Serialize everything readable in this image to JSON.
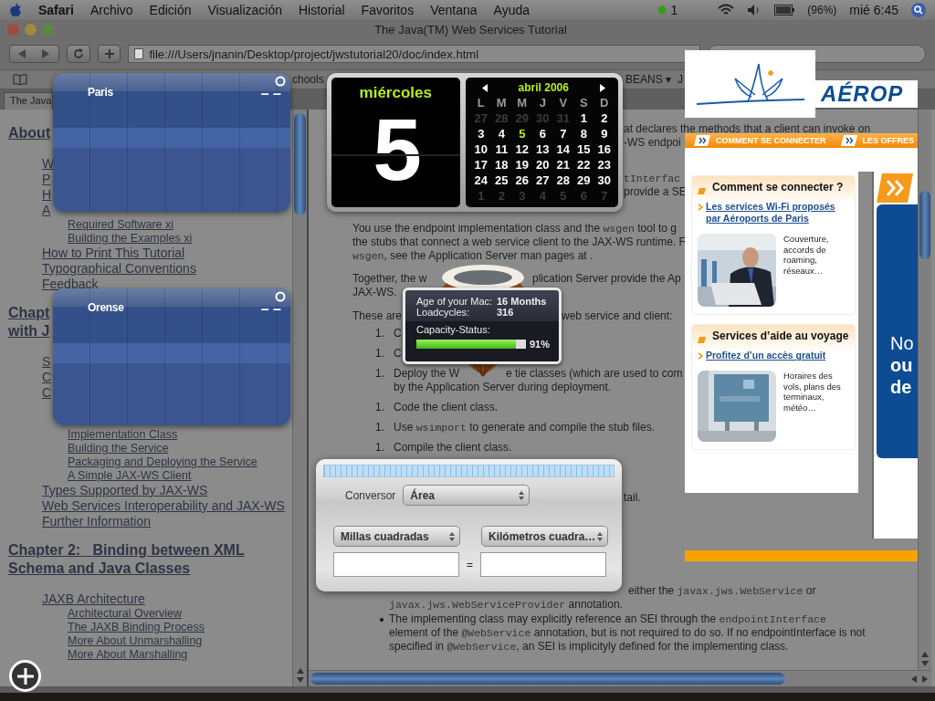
{
  "menubar": {
    "app": "Safari",
    "menus": [
      "Archivo",
      "Edición",
      "Visualización",
      "Historial",
      "Favoritos",
      "Ventana",
      "Ayuda"
    ],
    "status": "1",
    "battery": "(96%)",
    "clock": "mié 6:45"
  },
  "window": {
    "title": "The Java(TM) Web Services Tutorial"
  },
  "toolbar": {
    "url": "file:///Users/jnanin/Desktop/project/jwstutorial20/doc/index.html"
  },
  "bookmarks": [
    "chools",
    "BEANS ▾",
    "J"
  ],
  "tabs": [
    {
      "label": "The Java",
      "selected": true
    }
  ],
  "toc": [
    {
      "title": "About",
      "items": [
        {
          "text": "W"
        },
        {
          "text": "P"
        },
        {
          "text": "H"
        },
        {
          "text": "A",
          "children": [
            {
              "text": "Required Software xi"
            },
            {
              "text": "Building the Examples xi"
            }
          ]
        },
        {
          "text": "How to Print This Tutorial"
        },
        {
          "text": "Typographical Conventions"
        },
        {
          "text": "Feedback"
        }
      ]
    },
    {
      "title": "Chapt\nwith J",
      "items": [
        {
          "text": "S"
        },
        {
          "text": "C"
        },
        {
          "text": "C",
          "children": [
            {
              "text": "Implementation Class"
            },
            {
              "text": "Building the Service"
            },
            {
              "text": "Packaging and Deploying the Service"
            },
            {
              "text": "A Simple JAX-WS Client"
            }
          ]
        },
        {
          "text": "Types Supported by JAX-WS"
        },
        {
          "text": "Web Services Interoperability and JAX-WS"
        },
        {
          "text": "Further Information"
        }
      ]
    },
    {
      "title": "Chapter 2:   Binding between XML\nSchema and Java Classes",
      "items": [
        {
          "text": "JAXB Architecture",
          "children": [
            {
              "text": "Architectural Overview"
            },
            {
              "text": "The JAXB Binding Process"
            },
            {
              "text": "More About Unmarshalling"
            },
            {
              "text": "More About Marshalling"
            }
          ]
        }
      ]
    }
  ],
  "content": [
    {
      "kind": "tail",
      "lines": [
        [
          [
            {
              "text": "at declares the methods that a client can invoke on"
            }
          ]
        ],
        [
          [
            {
              "text": "-WS endpoi"
            }
          ]
        ]
      ]
    },
    {
      "kind": "tail",
      "lines": [
        [
          [
            {
              "code": "tInterfac"
            }
          ]
        ],
        [
          [
            {
              "text": "provide a SE"
            }
          ]
        ]
      ]
    },
    {
      "kind": "para",
      "lines": [
        [
          [
            {
              "text": "You use the endpoint implementation class and the "
            },
            {
              "code": "wsgen"
            },
            {
              "text": " tool to g"
            }
          ]
        ],
        [
          [
            {
              "text": "the stubs that connect a web service client to the JAX-WS runtime. F"
            }
          ]
        ],
        [
          [
            {
              "code": "wsgen"
            },
            {
              "text": ", see the Application Server man pages at ."
            }
          ]
        ]
      ]
    },
    {
      "kind": "para",
      "lines": [
        [
          [
            {
              "text": "Together, the w"
            }
          ],
          [
            {
              "text": "plication Server provide the Ap"
            }
          ]
        ],
        [
          [
            {
              "text": "JAX-WS."
            }
          ]
        ]
      ]
    },
    {
      "kind": "para",
      "lines": [
        [
          [
            {
              "text": "These are"
            }
          ],
          [
            {
              "text": "web service and client:"
            }
          ]
        ]
      ]
    },
    {
      "kind": "step",
      "number": "1.",
      "lines": [
        [
          [
            {
              "text": "C"
            }
          ]
        ]
      ]
    },
    {
      "kind": "step",
      "number": "1.",
      "lines": [
        [
          [
            {
              "text": "C"
            }
          ]
        ]
      ]
    },
    {
      "kind": "step",
      "number": "1.",
      "lines": [
        [
          [
            {
              "text": "Deploy the W"
            }
          ],
          [
            {
              "text": "e tie classes (which are used to com"
            }
          ]
        ],
        [
          [
            {
              "text": "by the Application Server during deployment."
            }
          ]
        ]
      ]
    },
    {
      "kind": "step",
      "number": "1.",
      "lines": [
        [
          [
            {
              "text": "Code the client class."
            }
          ]
        ]
      ]
    },
    {
      "kind": "step",
      "number": "1.",
      "lines": [
        [
          [
            {
              "text": "Use "
            },
            {
              "code": "wsimport"
            },
            {
              "text": " to generate and compile the stub files."
            }
          ]
        ]
      ]
    },
    {
      "kind": "step",
      "number": "1.",
      "lines": [
        [
          [
            {
              "text": "Compile the client class."
            }
          ]
        ]
      ]
    },
    {
      "kind": "tail",
      "lines": [
        [
          [
            {
              "text": "tail."
            }
          ]
        ]
      ]
    },
    {
      "kind": "continued",
      "lines": [
        [
          [
            {
              "text": "either the "
            },
            {
              "code": "javax.jws.WebService"
            },
            {
              "text": " or"
            }
          ]
        ],
        [
          [
            {
              "code": "javax.jws.WebServiceProvider"
            },
            {
              "text": " annotation."
            }
          ]
        ]
      ]
    },
    {
      "kind": "bullet",
      "lines": [
        [
          [
            {
              "text": "The implementing class may explicitly reference an SEI through the "
            },
            {
              "code": "endpointInterface"
            }
          ]
        ],
        [
          [
            {
              "text": "element of the "
            },
            {
              "code": "@WebService"
            },
            {
              "text": " annotation, but is not required to do so. If no endpointInterface is not"
            }
          ]
        ],
        [
          [
            {
              "text": "specified in "
            },
            {
              "code": "@WebService"
            },
            {
              "text": ", an SEI is implicityly defined for the implementing class."
            }
          ]
        ]
      ]
    }
  ],
  "weather": [
    {
      "city": "Paris",
      "reading": "– –"
    },
    {
      "city": "Orense",
      "reading": "– –"
    }
  ],
  "calendar": {
    "weekday": "miércoles",
    "day": "5",
    "month": "abril 2006",
    "weekdays": [
      "L",
      "M",
      "M",
      "J",
      "V",
      "S",
      "D"
    ],
    "weeks": [
      [
        {
          "d": "27",
          "other": true,
          "selected": false
        },
        {
          "d": "28",
          "other": true,
          "selected": false
        },
        {
          "d": "29",
          "other": true,
          "selected": false
        },
        {
          "d": "30",
          "other": true,
          "selected": false
        },
        {
          "d": "31",
          "other": true,
          "selected": false
        },
        {
          "d": "1",
          "other": false,
          "selected": false
        },
        {
          "d": "2",
          "other": false,
          "selected": false
        }
      ],
      [
        {
          "d": "3",
          "other": false,
          "selected": false
        },
        {
          "d": "4",
          "other": false,
          "selected": false
        },
        {
          "d": "5",
          "other": false,
          "selected": true
        },
        {
          "d": "6",
          "other": false,
          "selected": false
        },
        {
          "d": "7",
          "other": false,
          "selected": false
        },
        {
          "d": "8",
          "other": false,
          "selected": false
        },
        {
          "d": "9",
          "other": false,
          "selected": false
        }
      ],
      [
        {
          "d": "10",
          "other": false,
          "selected": false
        },
        {
          "d": "11",
          "other": false,
          "selected": false
        },
        {
          "d": "12",
          "other": false,
          "selected": false
        },
        {
          "d": "13",
          "other": false,
          "selected": false
        },
        {
          "d": "14",
          "other": false,
          "selected": false
        },
        {
          "d": "15",
          "other": false,
          "selected": false
        },
        {
          "d": "16",
          "other": false,
          "selected": false
        }
      ],
      [
        {
          "d": "17",
          "other": false,
          "selected": false
        },
        {
          "d": "18",
          "other": false,
          "selected": false
        },
        {
          "d": "19",
          "other": false,
          "selected": false
        },
        {
          "d": "20",
          "other": false,
          "selected": false
        },
        {
          "d": "21",
          "other": false,
          "selected": false
        },
        {
          "d": "22",
          "other": false,
          "selected": false
        },
        {
          "d": "23",
          "other": false,
          "selected": false
        }
      ],
      [
        {
          "d": "24",
          "other": false,
          "selected": false
        },
        {
          "d": "25",
          "other": false,
          "selected": false
        },
        {
          "d": "26",
          "other": false,
          "selected": false
        },
        {
          "d": "27",
          "other": false,
          "selected": false
        },
        {
          "d": "28",
          "other": false,
          "selected": false
        },
        {
          "d": "29",
          "other": false,
          "selected": false
        },
        {
          "d": "30",
          "other": false,
          "selected": false
        }
      ],
      [
        {
          "d": "1",
          "other": true,
          "selected": false
        },
        {
          "d": "2",
          "other": true,
          "selected": false
        },
        {
          "d": "3",
          "other": true,
          "selected": false
        },
        {
          "d": "4",
          "other": true,
          "selected": false
        },
        {
          "d": "5",
          "other": true,
          "selected": false
        },
        {
          "d": "6",
          "other": true,
          "selected": false
        },
        {
          "d": "7",
          "other": true,
          "selected": false
        }
      ]
    ]
  },
  "battery": {
    "rows": [
      {
        "label": "Age of your Mac:",
        "value": "16 Months"
      },
      {
        "label": "Loadcycles:",
        "value": "316"
      }
    ],
    "capacity": {
      "label": "Capacity-Status:",
      "level": 0.91,
      "reading": "91%"
    }
  },
  "converter": {
    "label": "Conversor",
    "category": "Área",
    "from_unit": "Millas cuadradas",
    "to_unit": "Kilómetros cuadra…",
    "equals": "="
  },
  "airport": {
    "brand": "AÉROP",
    "nav": [
      "COMMENT SE CONNECTER",
      "LES OFFRES"
    ],
    "cards": [
      {
        "title": "Comment se connecter ?",
        "link": "Les services Wi-Fi proposés par Aéroports de Paris",
        "text": "Couverture, accords de roaming, réseaux…",
        "kind": "person"
      },
      {
        "title": "Services d’aide au voyage",
        "link": "Profitez d’un accès gratuit",
        "text": "Horaires des vols, plans des terminaux, météo…",
        "kind": "sign"
      }
    ],
    "promo": [
      "No",
      "ou",
      "de"
    ]
  }
}
